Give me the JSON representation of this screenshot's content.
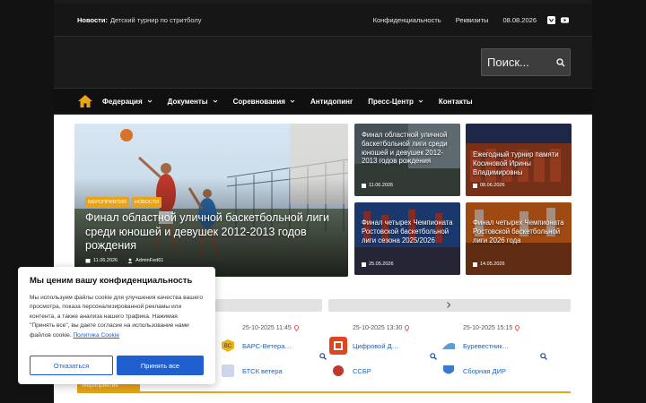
{
  "topbar": {
    "news_label": "Новости:",
    "news_text": "Детский турнир по стритболу",
    "privacy": "Конфиденциальность",
    "requisites": "Реквизиты",
    "date": "08.08.2026",
    "social_icons": [
      "vk-icon",
      "youtube-icon"
    ]
  },
  "search": {
    "placeholder": "Поиск..."
  },
  "nav": {
    "items": [
      {
        "label": "Федерация"
      },
      {
        "label": "Документы"
      },
      {
        "label": "Соревнования"
      },
      {
        "label": "Антидопинг"
      },
      {
        "label": "Пресс-Центр"
      },
      {
        "label": "Контакты"
      }
    ]
  },
  "hero": {
    "tags": [
      "МЕРОПРИЯТИЯ",
      "НОВОСТИ"
    ],
    "title": "Финал областной уличной баскетбольной лиги среди юношей и девушек 2012-2013 годов рождения",
    "date": "11.06.2026",
    "author": "AdminFed61"
  },
  "cards": [
    {
      "title": "Финал областной уличной баскетбольной лиги среди юношей и девушек 2012-2013 годов рождения",
      "date": "11.06.2026"
    },
    {
      "title": "Ежегодный турнир памяти Косиновой Ирины Владимировны",
      "date": "08.06.2026"
    },
    {
      "title": "Финал четырех Чемпионата Ростовской баскетбольной лиги сезона 2025/2026",
      "date": "25.05.2026"
    },
    {
      "title": "Финал четырех Чемпионата Ростовской баскетбольной лиги 2026 года",
      "date": "14.05.2026"
    }
  ],
  "matches": [
    {
      "time": "25-10-2025 11:45",
      "team1": "БАРС-Ветера…",
      "team2": "БТСК ветера"
    },
    {
      "time": "25-10-2025 13:30",
      "team1": "Цифровой Д…",
      "team2": "ССБР"
    },
    {
      "time": "25-10-2025 15:15",
      "team1": "Буревестник…",
      "team2": "Сборная ДИР"
    }
  ],
  "section_tab": "Мероприятия",
  "cookie": {
    "title": "Мы ценим вашу конфиденциальность",
    "text": "Мы используем файлы cookie для улучшения качества вашего просмотра, показа персонализированной рекламы или контента, а также анализа нашего трафика. Нажимая \"Принять все\", вы даете согласие на использование нами файлов cookie.",
    "policy_link": "Политика Cookie",
    "reject": "Отказаться",
    "accept": "Принять все"
  },
  "colors": {
    "accent": "#e8a317",
    "link": "#1a5ad8",
    "dark": "#1b1b1b"
  }
}
